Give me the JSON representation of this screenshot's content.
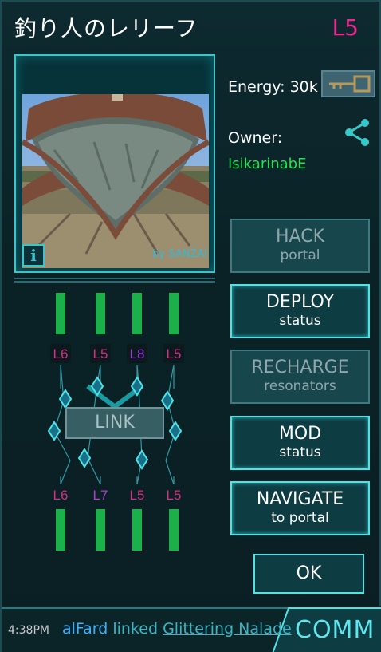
{
  "portal": {
    "title": "釣り人のレリーフ",
    "level": "L5",
    "photo_credit": "by SANZAI",
    "info_label": "i"
  },
  "energy_label": "Energy: 30k",
  "owner": {
    "label": "Owner:",
    "name": "IsikarinabE"
  },
  "actions": [
    {
      "line1": "HACK",
      "line2": "portal",
      "enabled": false
    },
    {
      "line1": "DEPLOY",
      "line2": "status",
      "enabled": true
    },
    {
      "line1": "RECHARGE",
      "line2": "resonators",
      "enabled": false
    },
    {
      "line1": "MOD",
      "line2": "status",
      "enabled": true
    },
    {
      "line1": "NAVIGATE",
      "line2": "to portal",
      "enabled": true
    }
  ],
  "ok_label": "OK",
  "link_label": "LINK",
  "resonators": {
    "top": [
      {
        "level": "L6",
        "color": "#d32f85"
      },
      {
        "level": "L5",
        "color": "#d32f85"
      },
      {
        "level": "L8",
        "color": "#9a35e0"
      },
      {
        "level": "L5",
        "color": "#d32f85"
      }
    ],
    "bottom": [
      {
        "level": "L6",
        "color": "#d32f85"
      },
      {
        "level": "L7",
        "color": "#b23ec9"
      },
      {
        "level": "L5",
        "color": "#d32f85"
      },
      {
        "level": "L5",
        "color": "#d32f85"
      }
    ],
    "bar_color": "#1bb04a"
  },
  "footer": {
    "time": "4:38PM",
    "user": "alFard",
    "verb": "linked",
    "target": "Glittering Nalade",
    "comm_label": "COMM"
  },
  "colors": {
    "accent": "#4ee3e6",
    "level": "#ee2a8f",
    "owner": "#1ce84e"
  }
}
